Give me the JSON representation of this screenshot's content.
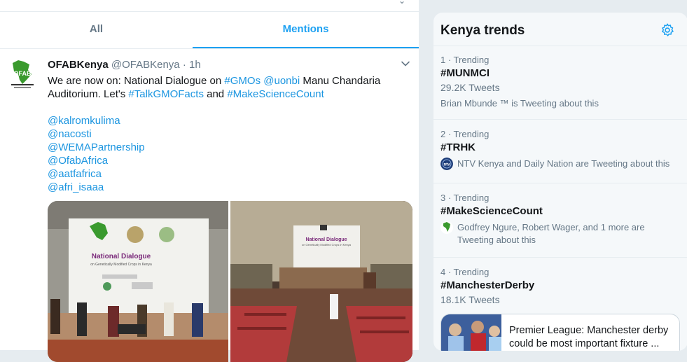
{
  "tabs": {
    "all": "All",
    "mentions": "Mentions"
  },
  "tweet": {
    "name": "OFABKenya",
    "handle": "@OFABKenya",
    "sep": "·",
    "time": "1h",
    "lines": [
      [
        {
          "t": "We are now on: National Dialogue on "
        },
        {
          "t": "#GMOs",
          "link": true
        },
        {
          "t": " "
        },
        {
          "t": "@uonbi",
          "link": true
        },
        {
          "t": " Manu Chandaria"
        }
      ],
      [
        {
          "t": "Auditorium. Let's "
        },
        {
          "t": "#TalkGMOFacts",
          "link": true
        },
        {
          "t": " and "
        },
        {
          "t": "#MakeScienceCount",
          "link": true
        }
      ]
    ],
    "mentions": [
      "@kalromkulima",
      "@nacosti",
      "@WEMAPartnership",
      "@OfabAfrica",
      "@aatfafrica",
      "@afri_isaaa"
    ],
    "photo_left_text": {
      "title": "National Dialogue",
      "subtitle": "on Genetically Modified Crops in Kenya"
    },
    "photo_right_text": {
      "title": "National Dialogue",
      "subtitle": "on Genetically Modified Crops in Kenya"
    },
    "avatar_text": "OFAB"
  },
  "trends": {
    "title": "Kenya trends",
    "items": [
      {
        "meta": "1 · Trending",
        "name": "#MUNMCI",
        "count": "29.2K Tweets",
        "context": "Brian Mbunde ™ is Tweeting about this"
      },
      {
        "meta": "2 · Trending",
        "name": "#TRHK",
        "context": "NTV Kenya and Daily Nation are Tweeting about this",
        "context_icon": "ntv-logo-icon"
      },
      {
        "meta": "3 · Trending",
        "name": "#MakeScienceCount",
        "context": "Godfrey Ngure, Robert Wager, and 1 more are Tweeting about this",
        "context_icon": "ofab-avatar-icon"
      },
      {
        "meta": "4 · Trending",
        "name": "#ManchesterDerby",
        "count": "18.1K Tweets"
      }
    ],
    "card": {
      "text": "Premier League: Manchester derby could be most important fixture ..."
    }
  },
  "colors": {
    "accent": "#1da1f2",
    "link": "#1b95e0",
    "muted": "#657786",
    "text": "#14171a"
  }
}
